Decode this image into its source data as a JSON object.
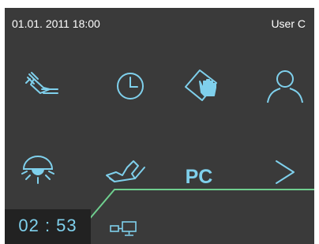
{
  "status": {
    "datetime": "01.01. 2011 18:00",
    "user": "User C"
  },
  "buttons_row1": [
    {
      "icon": "handpiece-icon"
    },
    {
      "icon": "clock-icon"
    },
    {
      "icon": "hand-touch-icon"
    },
    {
      "icon": "user-icon"
    }
  ],
  "buttons_row2": [
    {
      "icon": "operating-light-icon"
    },
    {
      "icon": "foot-control-icon"
    },
    {
      "label": "PC"
    },
    {
      "icon": "chevron-right-icon"
    }
  ],
  "timer": "02 : 53",
  "colors": {
    "background": "#3a3a3a",
    "icon": "#7fd0ec",
    "accent_line": "#6fcf8f",
    "text": "#ffffff"
  }
}
